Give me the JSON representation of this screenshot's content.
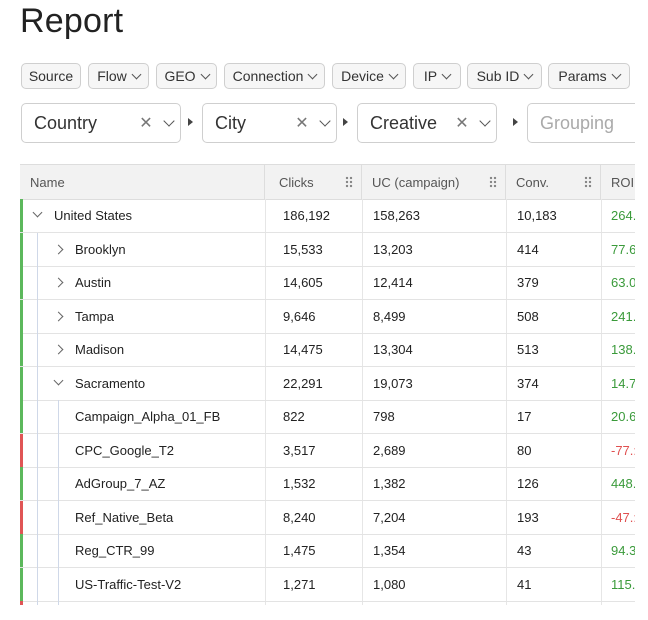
{
  "page": {
    "title": "Report"
  },
  "filters": [
    "Source",
    "Flow",
    "GEO",
    "Connection",
    "Device",
    "IP",
    "Sub ID",
    "Params"
  ],
  "grouping": [
    {
      "value": "Country",
      "placeholder": ""
    },
    {
      "value": "City",
      "placeholder": ""
    },
    {
      "value": "Creative",
      "placeholder": ""
    },
    {
      "value": "",
      "placeholder": "Grouping"
    }
  ],
  "table": {
    "headers": {
      "name": "Name",
      "clicks": "Clicks",
      "uc": "UC (campaign)",
      "conv": "Conv.",
      "roi": "ROI"
    },
    "rows": [
      {
        "level": 0,
        "expand": "down",
        "name": "United States",
        "clicks": "186,192",
        "uc": "158,263",
        "conv": "10,183",
        "roi": "264.",
        "status": "positive"
      },
      {
        "level": 1,
        "expand": "right",
        "name": "Brooklyn",
        "clicks": "15,533",
        "uc": "13,203",
        "conv": "414",
        "roi": "77.6",
        "status": "positive"
      },
      {
        "level": 1,
        "expand": "right",
        "name": "Austin",
        "clicks": "14,605",
        "uc": "12,414",
        "conv": "379",
        "roi": "63.0",
        "status": "positive"
      },
      {
        "level": 1,
        "expand": "right",
        "name": "Tampa",
        "clicks": "9,646",
        "uc": "8,499",
        "conv": "508",
        "roi": "241.",
        "status": "positive"
      },
      {
        "level": 1,
        "expand": "right",
        "name": "Madison",
        "clicks": "14,475",
        "uc": "13,304",
        "conv": "513",
        "roi": "138.",
        "status": "positive"
      },
      {
        "level": 1,
        "expand": "down",
        "name": "Sacramento",
        "clicks": "22,291",
        "uc": "19,073",
        "conv": "374",
        "roi": "14.7",
        "status": "positive"
      },
      {
        "level": 2,
        "expand": "",
        "name": "Campaign_Alpha_01_FB",
        "clicks": "822",
        "uc": "798",
        "conv": "17",
        "roi": "20.6",
        "status": "positive"
      },
      {
        "level": 2,
        "expand": "",
        "name": "CPC_Google_T2",
        "clicks": "3,517",
        "uc": "2,689",
        "conv": "80",
        "roi": "-77.:",
        "status": "negative"
      },
      {
        "level": 2,
        "expand": "",
        "name": "AdGroup_7_AZ",
        "clicks": "1,532",
        "uc": "1,382",
        "conv": "126",
        "roi": "448.",
        "status": "positive"
      },
      {
        "level": 2,
        "expand": "",
        "name": "Ref_Native_Beta",
        "clicks": "8,240",
        "uc": "7,204",
        "conv": "193",
        "roi": "-47.:",
        "status": "negative"
      },
      {
        "level": 2,
        "expand": "",
        "name": "Reg_CTR_99",
        "clicks": "1,475",
        "uc": "1,354",
        "conv": "43",
        "roi": "94.3",
        "status": "positive"
      },
      {
        "level": 2,
        "expand": "",
        "name": "US-Traffic-Test-V2",
        "clicks": "1,271",
        "uc": "1,080",
        "conv": "41",
        "roi": "115.",
        "status": "positive"
      },
      {
        "level": 2,
        "expand": "",
        "name": "",
        "clicks": "",
        "uc": "",
        "conv": "",
        "roi": "",
        "status": "negative"
      }
    ]
  },
  "colors": {
    "positive": "#3a9a3a",
    "negative": "#e05050",
    "stripe_positive": "#5cb85c",
    "stripe_negative": "#e05555"
  },
  "icons": {
    "chip_dropdown": "chevron-down-icon",
    "clear": "close-icon",
    "expand": "chevron-right-icon",
    "collapse": "chevron-down-icon",
    "column_drag": "drag-handle-icon"
  }
}
